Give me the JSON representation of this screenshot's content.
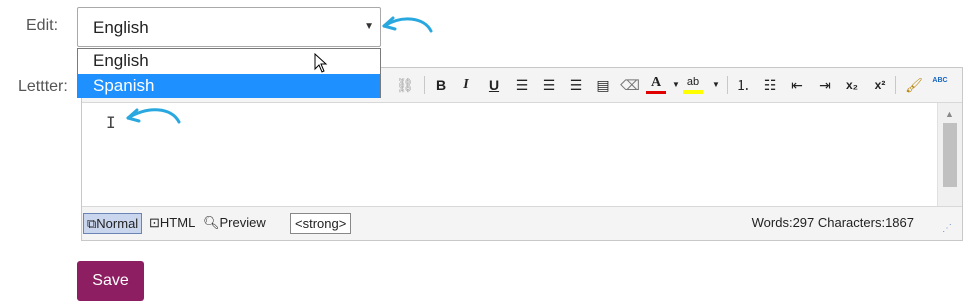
{
  "form": {
    "edit_label": "Edit:",
    "letter_label": "Lettter:",
    "save_label": "Save"
  },
  "language_select": {
    "selected": "English",
    "options": [
      "English",
      "Spanish"
    ],
    "highlighted": "Spanish"
  },
  "editor": {
    "toolbar": [
      "unlink-icon",
      "bold-icon",
      "italic-icon",
      "underline-icon",
      "align-left-icon",
      "align-center-icon",
      "align-right-icon",
      "justify-icon",
      "eraser-icon",
      "font-color-icon",
      "highlight-icon",
      "ordered-list-icon",
      "unordered-list-icon",
      "outdent-icon",
      "indent-icon",
      "subscript-icon",
      "superscript-icon",
      "format-painter-icon",
      "spellcheck-icon"
    ],
    "toolbar_text": {
      "bold": "B",
      "italic": "I",
      "underline": "U",
      "font_color": "A",
      "highlight": "ab",
      "subscript": "x₂",
      "superscript": "x²",
      "spellcheck": "ABC"
    },
    "modes": {
      "normal": "Normal",
      "html": "HTML",
      "preview": "Preview"
    },
    "active_mode": "Normal",
    "current_tag": "<strong>",
    "stats": "Words:297 Characters:1867"
  },
  "colors": {
    "accent_blue": "#1e90ff",
    "annotation_arrow": "#29a8e0",
    "save_button": "#8e1e62",
    "font_color_bar": "#e00000",
    "highlight_bar": "#ffff00"
  }
}
